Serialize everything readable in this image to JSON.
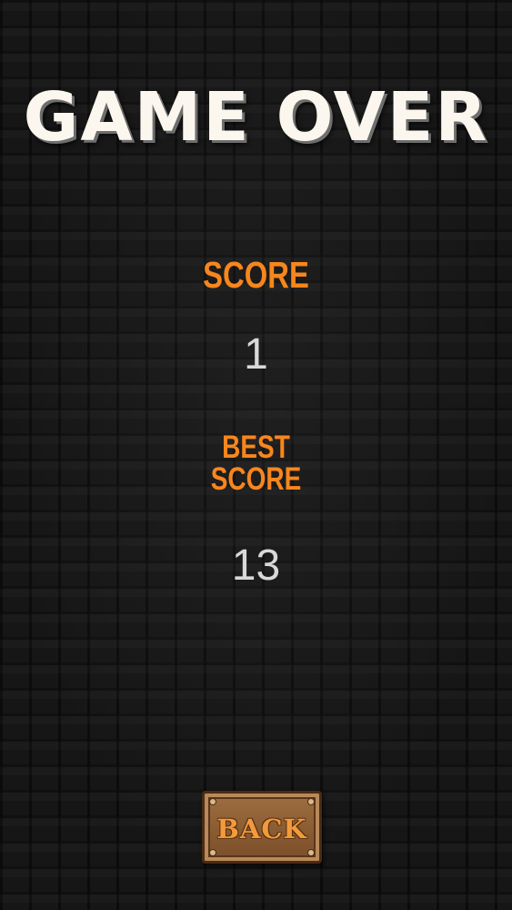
{
  "screen": {
    "title": "GAME OVER",
    "score_label": "SCORE",
    "score_value": "1",
    "best_label_line1": "BEST",
    "best_label_line2": "SCORE",
    "best_value": "13",
    "back_button_label": "BACK"
  },
  "colors": {
    "title": "#fbf7ef",
    "label_orange": "#f7861d",
    "value_grey": "#d9d9d9",
    "button_wood": "#8a5c33",
    "background": "#161616"
  },
  "background_texture": "dark-brick-wall"
}
